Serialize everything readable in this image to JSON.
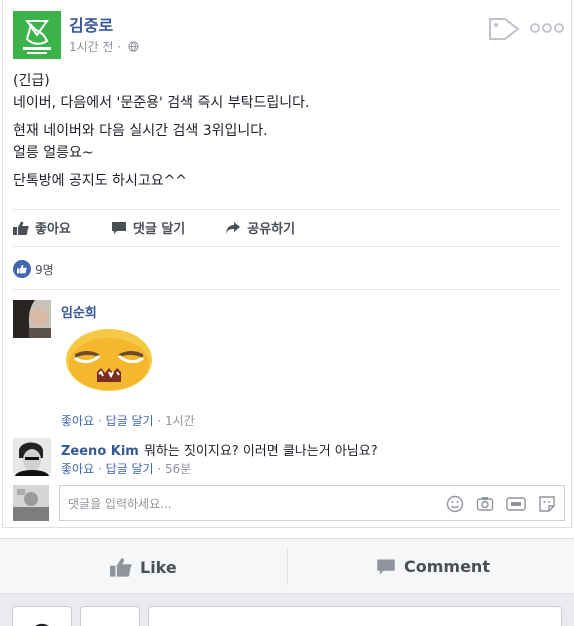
{
  "post": {
    "author": "김중로",
    "time": "1시간 전 ·",
    "lines": [
      "(긴급)",
      "네이버, 다음에서 '문준용' 검색 즉시 부탁드립니다.",
      "현재 네이버와 다음 실시간 검색 3위입니다.",
      "얼릉 얼릉요~",
      "단톡방에 공지도 하시고요^^"
    ]
  },
  "actions": {
    "like": "좋아요",
    "comment": "댓글 달기",
    "share": "공유하기"
  },
  "likes": {
    "count": "9명"
  },
  "comments": [
    {
      "name": "임순희",
      "text": "",
      "meta": {
        "like": "좋아요",
        "reply": "답글 달기",
        "time": "· 1시간"
      }
    },
    {
      "name": "Zeeno Kim",
      "text": "뭐하는 짓이지요? 이러면 클나는거 아님요?",
      "meta": {
        "like": "좋아요",
        "reply": "답글 달기",
        "time": "· 56분"
      }
    }
  ],
  "composer": {
    "placeholder": "댓글을 입력하세요..."
  },
  "bottom_bar": {
    "like": "Like",
    "comment": "Comment"
  },
  "colors": {
    "link": "#365899",
    "accent": "#4267b2",
    "brand_green": "#3bb34a",
    "muted": "#90949c"
  },
  "icons": [
    "tag-icon",
    "more-icon",
    "thumb-up-icon",
    "speech-bubble-icon",
    "share-arrow-icon",
    "emoji-icon",
    "camera-icon",
    "gif-icon",
    "sticker-icon"
  ]
}
